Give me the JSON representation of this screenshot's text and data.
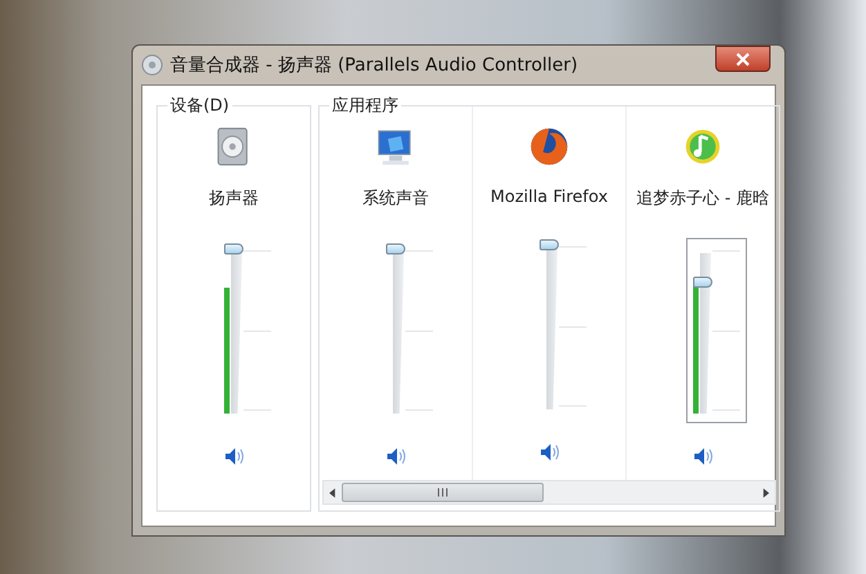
{
  "window": {
    "title": "音量合成器 - 扬声器 (Parallels Audio Controller)"
  },
  "device_group": {
    "label": "设备(D)",
    "channels": [
      {
        "name": "扬声器",
        "kind": "speaker",
        "volume": {
          "level": 1.0
        },
        "meter": {
          "level": 0.76
        },
        "muted": false,
        "focused": false
      }
    ]
  },
  "app_group": {
    "label": "应用程序",
    "channels": [
      {
        "name": "系统声音",
        "kind": "system",
        "volume": {
          "level": 1.0
        },
        "meter": {
          "level": 0
        },
        "muted": false,
        "focused": false
      },
      {
        "name": "Mozilla Firefox",
        "kind": "browser",
        "volume": {
          "level": 1.0
        },
        "meter": {
          "level": 0
        },
        "muted": false,
        "focused": false
      },
      {
        "name": "追梦赤子心 - 鹿晗",
        "kind": "music",
        "volume": {
          "level": 0.8
        },
        "meter": {
          "level": 0.8
        },
        "muted": false,
        "focused": true
      }
    ]
  }
}
